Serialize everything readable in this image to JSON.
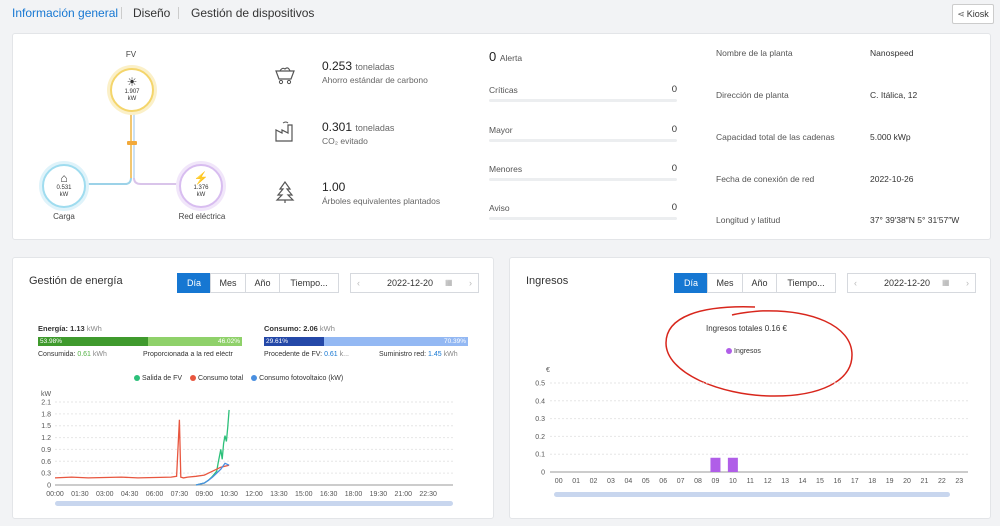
{
  "nav": {
    "tabs": [
      "Información general",
      "Diseño",
      "Gestión de dispositivos"
    ],
    "kiosk_label": "Kiosk"
  },
  "flow": {
    "pv": {
      "label": "FV",
      "value": "1.907",
      "unit": "kW"
    },
    "load": {
      "label": "Carga",
      "value": "0.531",
      "unit": "kW"
    },
    "grid": {
      "label": "Red eléctrica",
      "value": "1.376",
      "unit": "kW"
    }
  },
  "env": {
    "carbon": {
      "value": "0.253",
      "unit": "toneladas",
      "label": "Ahorro estándar de carbono"
    },
    "co2": {
      "value": "0.301",
      "unit": "toneladas",
      "label": "CO₂ evitado"
    },
    "trees": {
      "value": "1.00",
      "label": "Árboles equivalentes plantados"
    }
  },
  "alerts": {
    "total": "0",
    "total_label": "Alerta",
    "rows": [
      {
        "label": "Críticas",
        "value": "0"
      },
      {
        "label": "Mayor",
        "value": "0"
      },
      {
        "label": "Menores",
        "value": "0"
      },
      {
        "label": "Aviso",
        "value": "0"
      }
    ]
  },
  "plant": [
    {
      "label": "Nombre de la planta",
      "value": "Nanospeed"
    },
    {
      "label": "Dirección de planta",
      "value": "C. Itálica, 12"
    },
    {
      "label": "Capacidad total de las cadenas",
      "value": "5.000 kWp"
    },
    {
      "label": "Fecha de conexión de red",
      "value": "2022-10-26"
    },
    {
      "label": "Longitud y latitud",
      "value": "37° 39′38″N   5° 31′57″W"
    }
  ],
  "energy": {
    "title": "Gestión de energía",
    "periods": [
      "Día",
      "Mes",
      "Año",
      "Tiempo..."
    ],
    "date": "2022-12-20",
    "produced": {
      "label": "Energía:",
      "value": "1.13",
      "unit": "kWh",
      "pct_self": "53.98%",
      "pct_grid": "46.02%",
      "self_frac": 0.5398,
      "self_label": "Consumida:",
      "self_value": "0.61",
      "self_unit": "kWh",
      "grid_label": "Proporcionada a la red eléctr"
    },
    "consumed": {
      "label": "Consumo:",
      "value": "2.06",
      "unit": "kWh",
      "pct_pv": "29.61%",
      "pct_grid": "70.39%",
      "pv_frac": 0.2961,
      "pv_label": "Procedente de FV:",
      "pv_value": "0.61",
      "pv_unit": "k...",
      "grid_label": "Suministro red:",
      "grid_value": "1.45",
      "grid_unit": "kWh"
    },
    "legend": [
      "Salida de FV",
      "Consumo total",
      "Consumo fotovoltaico (kW)"
    ],
    "colors": {
      "pv": "#2cc07a",
      "total": "#e8563f",
      "selfpv": "#4a8fe0",
      "self_bar": "#3f9a2d",
      "grid_bar": "#8fd16a",
      "cons_pv_bar": "#2448a8",
      "cons_grid_bar": "#93b8f3"
    }
  },
  "income": {
    "title": "Ingresos",
    "periods": [
      "Día",
      "Mes",
      "Año",
      "Tiempo..."
    ],
    "date": "2022-12-20",
    "total_label": "Ingresos totales 0.16 €",
    "series_label": "Ingresos",
    "color": "#b05ee8",
    "annotation_color": "#d8261c"
  },
  "chart_data": [
    {
      "type": "line",
      "ylabel": "kW",
      "ylim": [
        0,
        2.1
      ],
      "yticks": [
        "2.1",
        "1.8",
        "1.5",
        "1.2",
        "0.9",
        "0.6",
        "0.3",
        "0"
      ],
      "x_ticks": [
        "00:00",
        "01:30",
        "03:00",
        "04:30",
        "06:00",
        "07:30",
        "09:00",
        "10:30",
        "12:00",
        "13:30",
        "15:00",
        "16:30",
        "18:00",
        "19:30",
        "21:00",
        "22:30"
      ],
      "series": [
        {
          "name": "Salida de FV",
          "x": [
            "08:30",
            "09:00",
            "09:15",
            "09:30",
            "09:45",
            "09:50",
            "10:00",
            "10:05",
            "10:10",
            "10:15",
            "10:20",
            "10:25",
            "10:30"
          ],
          "values": [
            0.0,
            0.05,
            0.12,
            0.22,
            0.35,
            0.55,
            0.9,
            0.65,
            1.05,
            1.25,
            1.1,
            1.45,
            1.9
          ]
        },
        {
          "name": "Consumo total",
          "x": [
            "00:00",
            "01:00",
            "02:00",
            "03:00",
            "04:00",
            "05:00",
            "06:00",
            "07:00",
            "07:20",
            "07:30",
            "07:35",
            "07:45",
            "08:00",
            "08:30",
            "09:00",
            "09:30",
            "10:00",
            "10:30"
          ],
          "values": [
            0.18,
            0.2,
            0.18,
            0.19,
            0.2,
            0.18,
            0.19,
            0.2,
            0.22,
            1.65,
            0.2,
            0.18,
            0.2,
            0.22,
            0.25,
            0.35,
            0.45,
            0.5
          ]
        },
        {
          "name": "Consumo fotovoltaico (kW)",
          "x": [
            "08:30",
            "09:00",
            "09:15",
            "09:30",
            "09:45",
            "10:00",
            "10:15",
            "10:30"
          ],
          "values": [
            0.0,
            0.05,
            0.12,
            0.2,
            0.3,
            0.4,
            0.55,
            0.5
          ]
        }
      ]
    },
    {
      "type": "bar",
      "ylabel": "€",
      "ylim": [
        0,
        0.5
      ],
      "yticks": [
        "0.5",
        "0.4",
        "0.3",
        "0.2",
        "0.1",
        "0"
      ],
      "categories": [
        "00",
        "01",
        "02",
        "03",
        "04",
        "05",
        "06",
        "07",
        "08",
        "09",
        "10",
        "11",
        "12",
        "13",
        "14",
        "15",
        "16",
        "17",
        "18",
        "19",
        "20",
        "21",
        "22",
        "23"
      ],
      "series": [
        {
          "name": "Ingresos",
          "values": [
            0,
            0,
            0,
            0,
            0,
            0,
            0,
            0,
            0,
            0.08,
            0.08,
            0,
            0,
            0,
            0,
            0,
            0,
            0,
            0,
            0,
            0,
            0,
            0,
            0
          ]
        }
      ]
    }
  ]
}
